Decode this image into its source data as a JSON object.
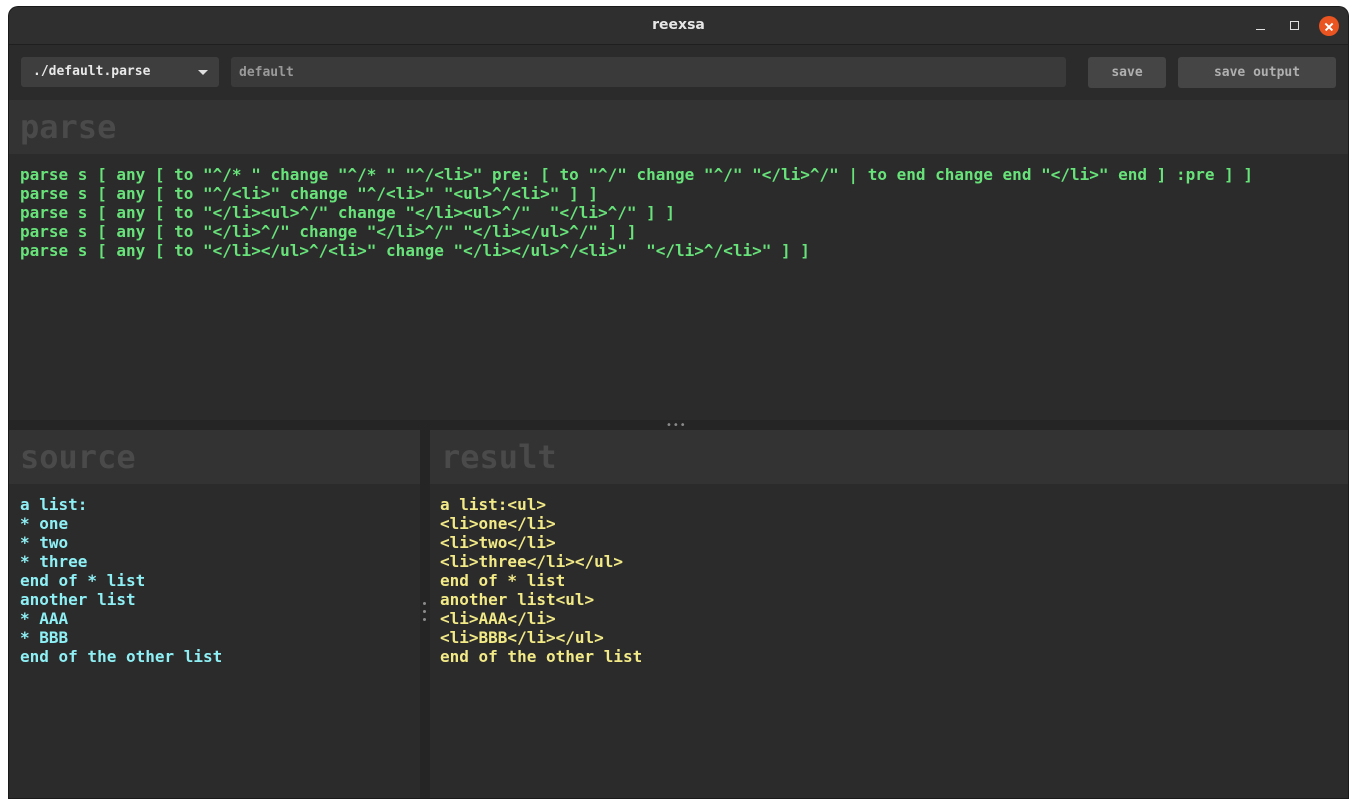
{
  "window": {
    "title": "reexsa"
  },
  "toolbar": {
    "file_select_value": "./default.parse",
    "name_input_value": "default",
    "save_label": "save",
    "save_output_label": "save output"
  },
  "parse_panel": {
    "heading": "parse",
    "code": "parse s [ any [ to \"^/* \" change \"^/* \" \"^/<li>\" pre: [ to \"^/\" change \"^/\" \"</li>^/\" | to end change end \"</li>\" end ] :pre ] ]\nparse s [ any [ to \"^/<li>\" change \"^/<li>\" \"<ul>^/<li>\" ] ]\nparse s [ any [ to \"</li><ul>^/\" change \"</li><ul>^/\"  \"</li>^/\" ] ]\nparse s [ any [ to \"</li>^/\" change \"</li>^/\" \"</li></ul>^/\" ] ]\nparse s [ any [ to \"</li></ul>^/<li>\" change \"</li></ul>^/<li>\"  \"</li>^/<li>\" ] ]"
  },
  "source_panel": {
    "heading": "source",
    "code": "a list:\n* one\n* two\n* three\nend of * list\nanother list\n* AAA\n* BBB\nend of the other list"
  },
  "result_panel": {
    "heading": "result",
    "code": "a list:<ul>\n<li>one</li>\n<li>two</li>\n<li>three</li></ul>\nend of * list\nanother list<ul>\n<li>AAA</li>\n<li>BBB</li></ul>\nend of the other list"
  },
  "colors": {
    "parse_text": "#67e37a",
    "source_text": "#8ef0f5",
    "result_text": "#f2e987",
    "close_button": "#e95420"
  },
  "icons": {
    "minimize": "minimize-icon",
    "maximize": "maximize-icon",
    "close": "close-icon",
    "dropdown": "chevron-down-icon"
  }
}
